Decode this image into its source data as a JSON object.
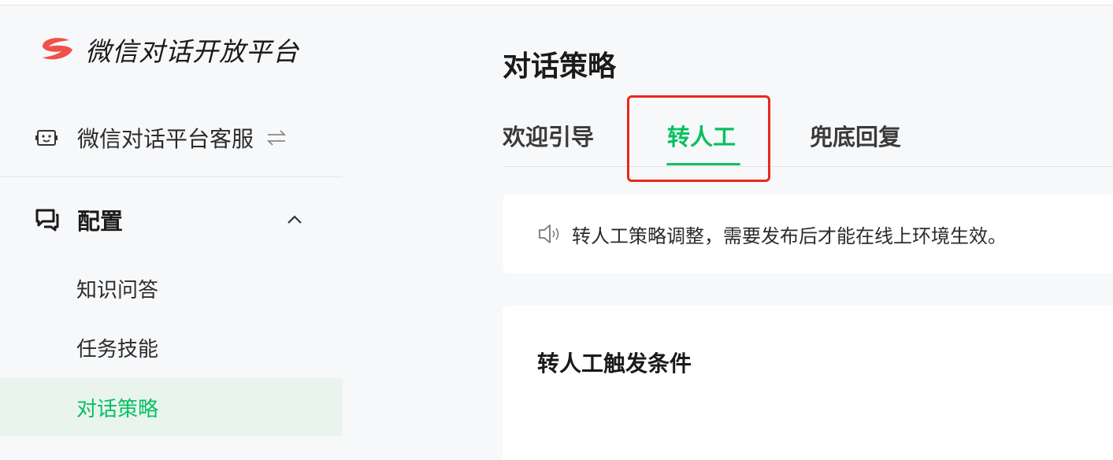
{
  "brand": {
    "name": "微信对话开放平台",
    "logo_icon": "brand-logo-icon",
    "logo_color": "#f0524b"
  },
  "account": {
    "name": "微信对话平台客服",
    "icon": "bot-icon",
    "switch_icon": "switch-icon"
  },
  "sidebar": {
    "group": {
      "label": "配置",
      "icon": "chat-config-icon",
      "expanded": true
    },
    "items": [
      {
        "label": "知识问答",
        "active": false
      },
      {
        "label": "任务技能",
        "active": false
      },
      {
        "label": "对话策略",
        "active": true
      }
    ]
  },
  "main": {
    "title": "对话策略",
    "tabs": [
      {
        "label": "欢迎引导",
        "active": false
      },
      {
        "label": "转人工",
        "active": true
      },
      {
        "label": "兜底回复",
        "active": false
      }
    ],
    "notice": {
      "icon": "speaker-icon",
      "text": "转人工策略调整，需要发布后才能在线上环境生效。"
    },
    "card": {
      "title": "转人工触发条件"
    }
  },
  "colors": {
    "accent": "#07c160",
    "highlight": "#e8281d",
    "sidebar_active_bg": "#eaf4ef"
  }
}
